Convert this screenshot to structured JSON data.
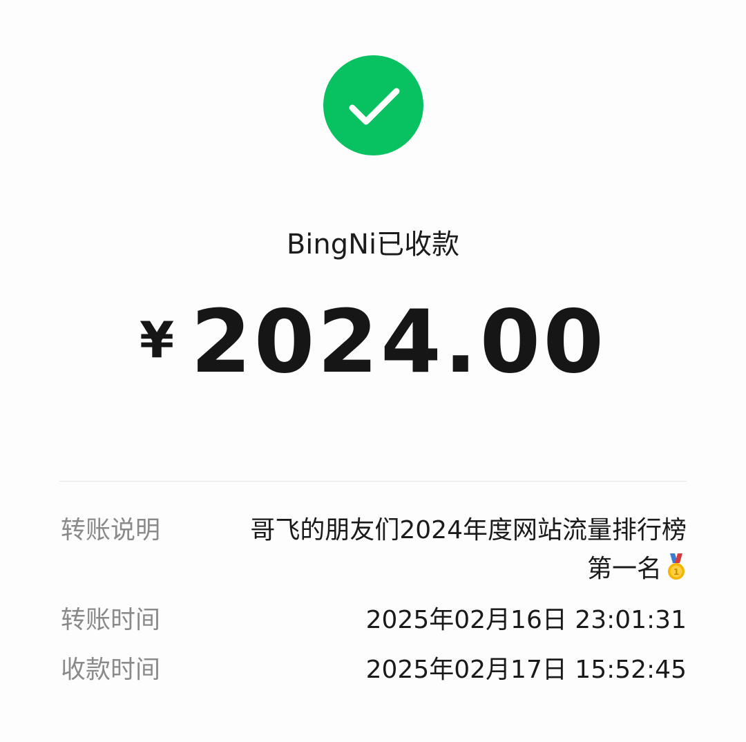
{
  "status": {
    "icon": "check-circle-icon",
    "text": "BingNi已收款"
  },
  "amount": {
    "currency": "¥",
    "value": "2024.00"
  },
  "details": {
    "transfer_note": {
      "label": "转账说明",
      "line1": "哥飞的朋友们2024年度网站流量排行榜",
      "line2": "第一名",
      "emoji": "gold-medal-icon"
    },
    "transfer_time": {
      "label": "转账时间",
      "value": "2025年02月16日 23:01:31"
    },
    "receive_time": {
      "label": "收款时间",
      "value": "2025年02月17日 15:52:45"
    }
  },
  "colors": {
    "success_green": "#08c160",
    "label_gray": "#8a8a8a",
    "text_dark": "#1a1a1a"
  }
}
